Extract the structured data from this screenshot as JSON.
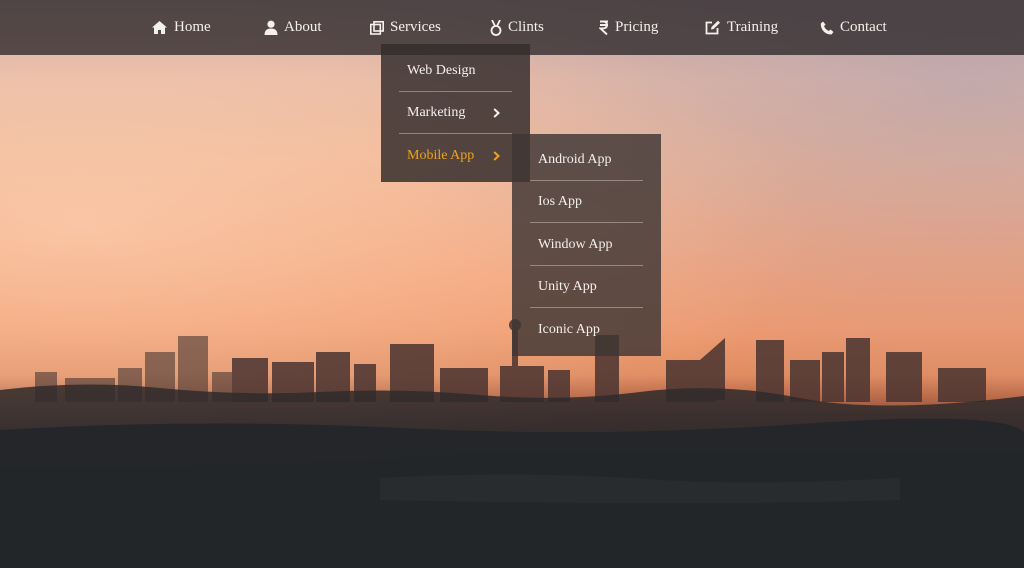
{
  "nav": {
    "items": [
      {
        "label": "Home",
        "icon": "home-icon"
      },
      {
        "label": "About",
        "icon": "user-icon"
      },
      {
        "label": "Services",
        "icon": "clone-icon"
      },
      {
        "label": "Clints",
        "icon": "medal-icon"
      },
      {
        "label": "Pricing",
        "icon": "rupee-icon"
      },
      {
        "label": "Training",
        "icon": "edit-icon"
      },
      {
        "label": "Contact",
        "icon": "phone-icon"
      }
    ]
  },
  "dropdown": {
    "items": [
      {
        "label": "Web Design"
      },
      {
        "label": "Marketing",
        "has_submenu": true
      },
      {
        "label": "Mobile App",
        "has_submenu": true,
        "active": true
      }
    ]
  },
  "submenu": {
    "items": [
      {
        "label": "Android App"
      },
      {
        "label": "Ios App"
      },
      {
        "label": "Window App"
      },
      {
        "label": "Unity App"
      },
      {
        "label": "Iconic App"
      }
    ]
  },
  "colors": {
    "active": "#f0a21e",
    "text": "#f4f0ec",
    "navbar": "#2d282a"
  }
}
